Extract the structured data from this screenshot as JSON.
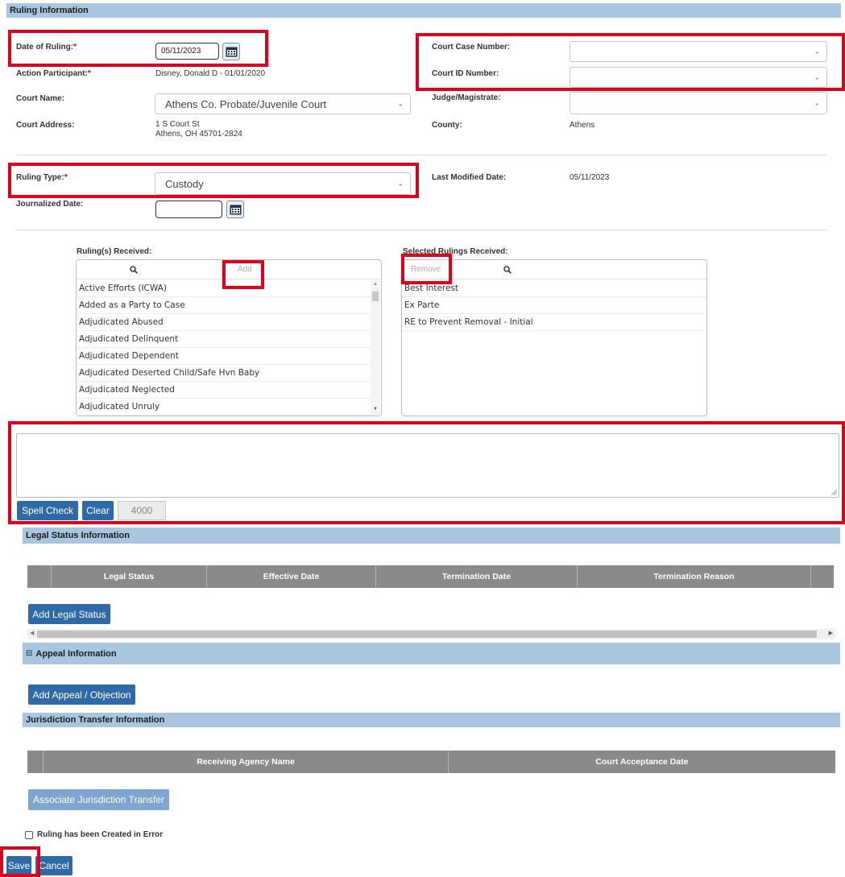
{
  "ruling_section": {
    "title": "Ruling Information",
    "date_of_ruling_label": "Date of Ruling:",
    "date_of_ruling_value": "05/11/2023",
    "action_participant_label": "Action Participant:",
    "action_participant_value": "Disney, Donald D - 01/01/2020",
    "court_name_label": "Court Name:",
    "court_name_value": "Athens Co. Probate/Juvenile Court",
    "court_address_label": "Court Address:",
    "court_address_line1": "1 S Court St",
    "court_address_line2": "Athens, OH 45701-2824",
    "court_case_number_label": "Court Case Number:",
    "court_case_number_value": "",
    "court_id_number_label": "Court ID Number:",
    "court_id_number_value": "",
    "judge_label": "Judge/Magistrate:",
    "judge_value": "",
    "county_label": "County:",
    "county_value": "Athens",
    "ruling_type_label": "Ruling Type:",
    "ruling_type_value": "Custody",
    "journalized_date_label": "Journalized Date:",
    "journalized_date_value": "",
    "last_modified_label": "Last Modified Date:",
    "last_modified_value": "05/11/2023",
    "required_mark": "*"
  },
  "rulings": {
    "received_label": "Ruling(s) Received:",
    "selected_label": "Selected Rulings Received:",
    "add_label": "Add",
    "remove_label": "Remove",
    "available": [
      "Active Efforts (ICWA)",
      "Added as a Party to Case",
      "Adjudicated Abused",
      "Adjudicated Delinquent",
      "Adjudicated Dependent",
      "Adjudicated Deserted Child/Safe Hvn Baby",
      "Adjudicated Neglected",
      "Adjudicated Unruly"
    ],
    "selected": [
      "Best Interest",
      "Ex Parte",
      "RE to Prevent Removal - Initial"
    ]
  },
  "narrative": {
    "spell_check_label": "Spell Check",
    "clear_label": "Clear",
    "char_count": "4000"
  },
  "legal_status": {
    "title": "Legal Status Information",
    "columns": [
      "Legal Status",
      "Effective Date",
      "Termination Date",
      "Termination Reason"
    ],
    "add_button": "Add Legal Status"
  },
  "appeal": {
    "title": "Appeal Information",
    "toggle": "⊟",
    "add_button": "Add Appeal / Objection"
  },
  "jurisdiction": {
    "title": "Jurisdiction Transfer Information",
    "columns": [
      "Receiving Agency Name",
      "Court Acceptance Date"
    ],
    "associate_button": "Associate Jurisdiction Transfer"
  },
  "footer": {
    "error_checkbox_label": "Ruling has been Created in Error",
    "save_label": "Save",
    "cancel_label": "Cancel"
  },
  "colors": {
    "section_bar": "#a9c6e1",
    "button_blue": "#2f6aa8",
    "highlight_red": "#e0001b",
    "grid_header": "#8a8a8a"
  }
}
